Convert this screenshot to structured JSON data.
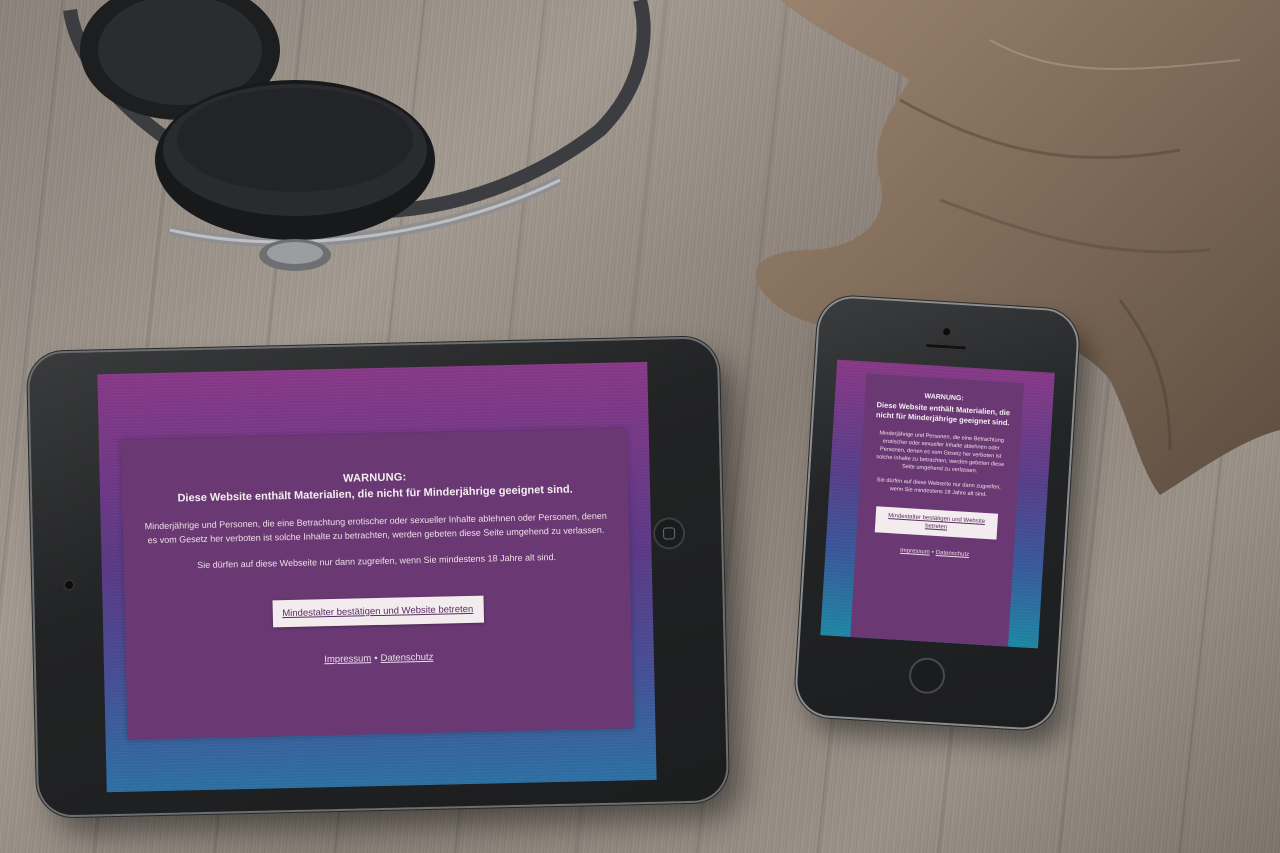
{
  "scene": {
    "background": "wooden-table",
    "objects": [
      "headphones-icon",
      "driftwood"
    ]
  },
  "tablet": {
    "warning_label": "WARNUNG:",
    "headline": "Diese Website enthält Materialien, die nicht für Minderjährige geeignet sind.",
    "body": "Minderjährige und Personen, die eine Betrachtung erotischer oder sexueller Inhalte ablehnen oder Personen, denen es vom Gesetz her verboten ist solche Inhalte zu betrachten, werden gebeten diese Seite umgehend zu verlassen.",
    "age_note": "Sie dürfen auf diese Webseite nur dann zugreifen, wenn Sie mindestens 18 Jahre alt sind.",
    "confirm_button": "Mindestalter bestätigen und Website betreten",
    "imprint_link": "Impressum",
    "separator": "•",
    "privacy_link": "Datenschutz"
  },
  "phone": {
    "warning_label": "WARNUNG:",
    "headline": "Diese Website enthält Materialien, die nicht für Minderjährige geeignet sind.",
    "body": "Minderjährige und Personen, die eine Betrachtung erotischer oder sexueller Inhalte ablehnen oder Personen, denen es vom Gesetz her verboten ist solche Inhalte zu betrachten, werden gebeten diese Seite umgehend zu verlassen.",
    "age_note": "Sie dürfen auf diese Webseite nur dann zugreifen, wenn Sie mindestens 18 Jahre alt sind.",
    "confirm_button": "Mindestalter bestätigen und Website betreten",
    "imprint_link": "Impressum",
    "separator": "•",
    "privacy_link": "Datenschutz"
  },
  "colors": {
    "panel": "#6a3973",
    "button_bg": "#f3ecee",
    "button_text": "#5a2e63",
    "gradient_top": "#8a3a8a",
    "gradient_bottom": "#2e72a6"
  }
}
